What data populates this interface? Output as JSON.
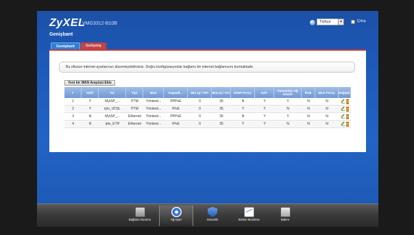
{
  "header": {
    "logo": "ZyXEL",
    "model": "VMG3312-B10B",
    "page_title": "Genişbant",
    "language": "Türkçe",
    "logout": "Çıkış"
  },
  "tabs": [
    {
      "label": "Genişbant",
      "active": true
    },
    {
      "label": "Gelişmiş",
      "active": false
    }
  ],
  "info_text": "Bu ofiszon internet ayarlarınızı düzenleyebilirsiniz. Doğru konfigürasyonlar bağlamı bir internet bağlamısını kurmaktadır.",
  "add_button": "Yeni bir WAN Arayüzü Ekle",
  "table": {
    "headers": [
      "#",
      "Aktif",
      "Ad",
      "Tipi",
      "Mod",
      "Kapsüll...",
      "802.1p / VPI",
      "802.1q / VCI",
      "IGMP Proxy",
      "NAT",
      "Varsayılan Ağ Geçidi",
      "IPv6",
      "MLD Proxy",
      "Değiştir"
    ],
    "rows": [
      [
        "1",
        "Y",
        "MyISP_...",
        "PTM",
        "Yönlend...",
        "PPPoE",
        "0",
        "35",
        "N",
        "Y",
        "Y",
        "N",
        "N"
      ],
      [
        "2",
        "Y",
        "iptv_VDSL",
        "PTM",
        "Yönlend...",
        "IPoE",
        "0",
        "35",
        "Y",
        "Y",
        "N",
        "N",
        "N"
      ],
      [
        "3",
        "N",
        "MyISP_...",
        "Ethernet",
        "Yönlend...",
        "PPPoE",
        "0",
        "35",
        "N",
        "Y",
        "Y",
        "N",
        "N"
      ],
      [
        "4",
        "N",
        "iptv_ETH",
        "Ethernet",
        "Yönlend...",
        "IPoE",
        "0",
        "35",
        "Y",
        "Y",
        "N",
        "N",
        "N"
      ]
    ]
  },
  "dock": [
    {
      "label": "Bağlantı Durumu",
      "icon": "network-status-icon"
    },
    {
      "label": "Ağ Ayarı",
      "icon": "gear-icon",
      "selected": true
    },
    {
      "label": "Güvenlik",
      "icon": "shield-icon"
    },
    {
      "label": "Sistem Monitörü",
      "icon": "chart-icon"
    },
    {
      "label": "Bakım",
      "icon": "maintenance-icon"
    }
  ],
  "colors": {
    "background": "#1d5ab8",
    "accent_red": "#c43a3a",
    "table_header": "#7ea5dc"
  }
}
